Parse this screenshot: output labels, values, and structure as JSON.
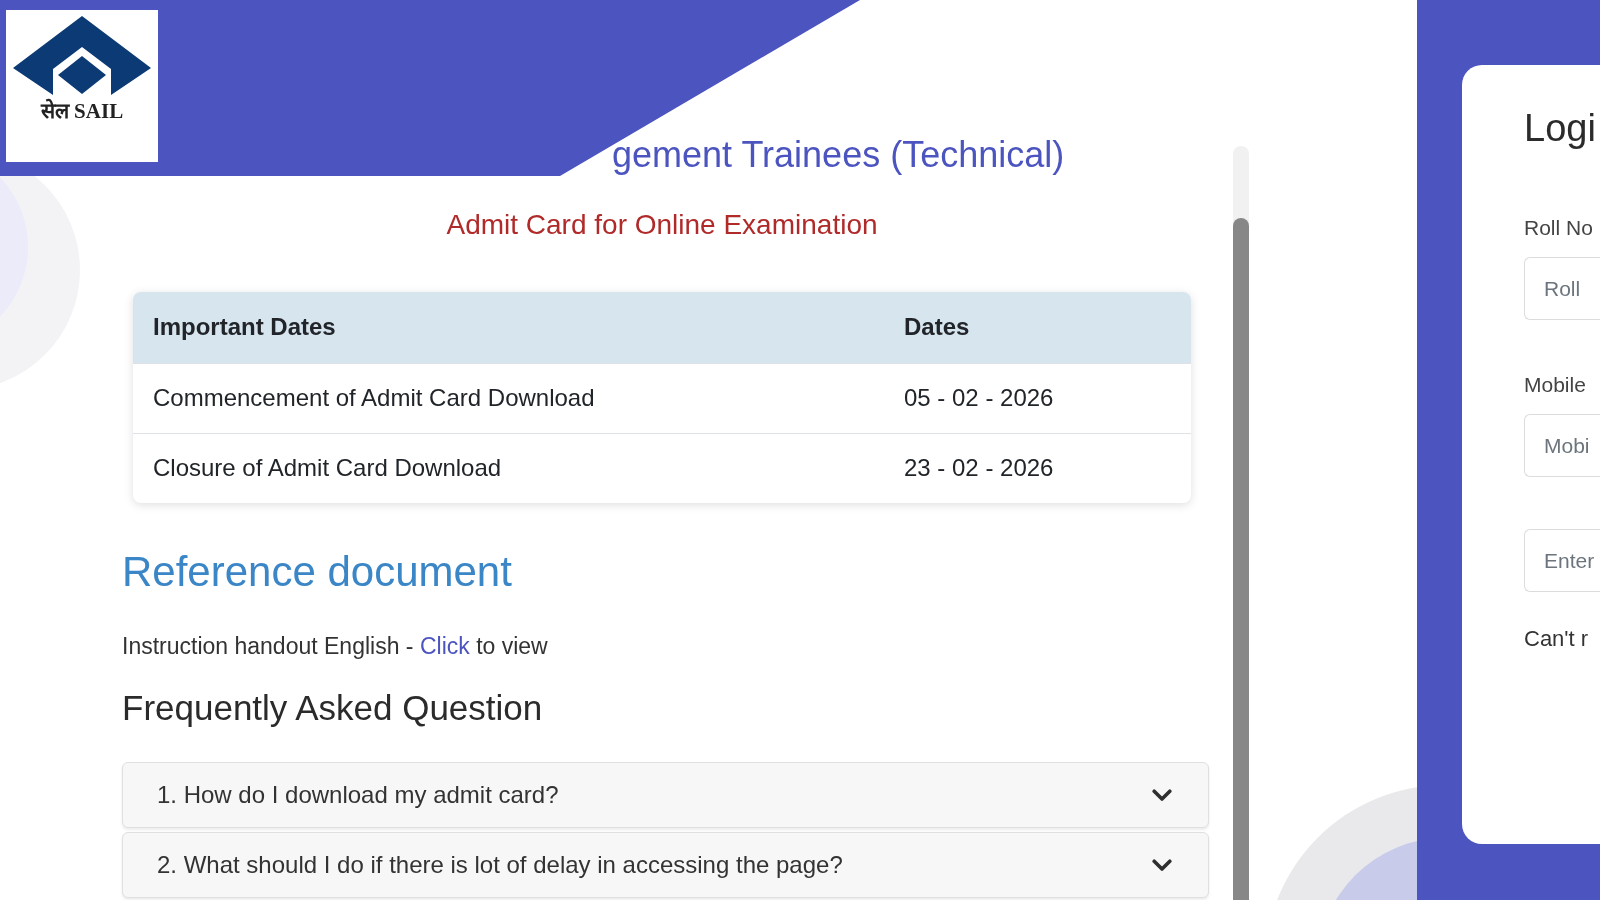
{
  "header": {
    "logo_text": "सेल SAIL",
    "title": "gement Trainees (Technical)"
  },
  "subtitle": "Admit Card for Online Examination",
  "dates_table": {
    "columns": [
      "Important Dates",
      "Dates"
    ],
    "rows": [
      [
        "Commencement of Admit Card Download",
        "05 - 02 - 2026"
      ],
      [
        "Closure of Admit Card Download",
        "23 - 02 - 2026"
      ]
    ]
  },
  "reference": {
    "heading": "Reference document",
    "text_before": "Instruction handout English - ",
    "link": "Click",
    "text_after": " to view"
  },
  "faq": {
    "heading": "Frequently Asked Question",
    "items": [
      {
        "question": "1. How do I download my admit card?",
        "expanded": false
      },
      {
        "question": "2. What should I do if there is lot of delay in accessing the page?",
        "expanded": false
      }
    ]
  },
  "login": {
    "title": "Logi",
    "fields": [
      {
        "label": "Roll No",
        "placeholder": "Roll"
      },
      {
        "label": "Mobile",
        "placeholder": "Mobi"
      },
      {
        "placeholder": "Enter"
      }
    ],
    "help_text": "Can't r"
  }
}
